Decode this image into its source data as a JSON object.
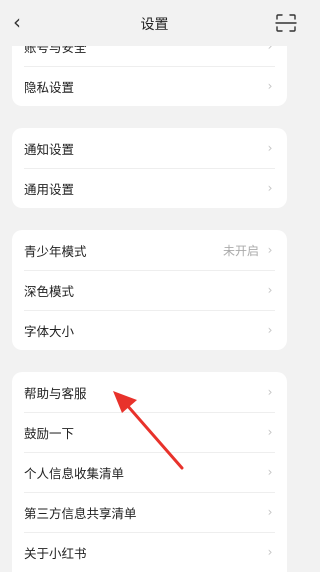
{
  "header": {
    "title": "设置",
    "back_icon": "chevron-left-icon",
    "scan_icon": "scan-icon"
  },
  "groups": [
    {
      "items": [
        {
          "label": "账号与安全",
          "value": ""
        },
        {
          "label": "隐私设置",
          "value": ""
        }
      ]
    },
    {
      "items": [
        {
          "label": "通知设置",
          "value": ""
        },
        {
          "label": "通用设置",
          "value": ""
        }
      ]
    },
    {
      "items": [
        {
          "label": "青少年模式",
          "value": "未开启"
        },
        {
          "label": "深色模式",
          "value": ""
        },
        {
          "label": "字体大小",
          "value": ""
        }
      ]
    },
    {
      "items": [
        {
          "label": "帮助与客服",
          "value": ""
        },
        {
          "label": "鼓励一下",
          "value": ""
        },
        {
          "label": "个人信息收集清单",
          "value": ""
        },
        {
          "label": "第三方信息共享清单",
          "value": ""
        },
        {
          "label": "关于小红书",
          "value": ""
        }
      ]
    }
  ],
  "annotation": {
    "color": "#e8322b",
    "points_to": "帮助与客服"
  },
  "colors": {
    "background": "#f2f2f2",
    "card": "#ffffff",
    "chevron": "#c4c4c4",
    "muted_text": "#aaaaaa"
  }
}
